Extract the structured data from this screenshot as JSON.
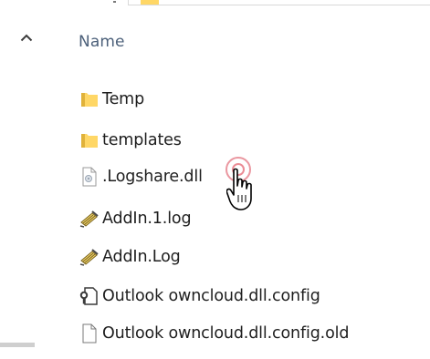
{
  "colors": {
    "header_text": "#4c607a",
    "folder_yellow": "#ffd766",
    "folder_dark": "#e0b23a",
    "text": "#1e1e1e",
    "click_ring": "#e88c96"
  },
  "nav": {
    "scroll_up_icon": "chevron-up-icon"
  },
  "header": {
    "name_label": "Name"
  },
  "files": [
    {
      "name": "Temp",
      "icon": "folder-icon"
    },
    {
      "name": "templates",
      "icon": "folder-icon"
    },
    {
      "name": ".Logshare.dll",
      "icon": "dll-file-icon"
    },
    {
      "name": "AddIn.1.log",
      "icon": "log-file-icon"
    },
    {
      "name": "AddIn.Log",
      "icon": "log-file-icon"
    },
    {
      "name": "Outlook owncloud.dll.config",
      "icon": "config-file-icon"
    },
    {
      "name": "Outlook owncloud.dll.config.old",
      "icon": "blank-file-icon"
    }
  ]
}
